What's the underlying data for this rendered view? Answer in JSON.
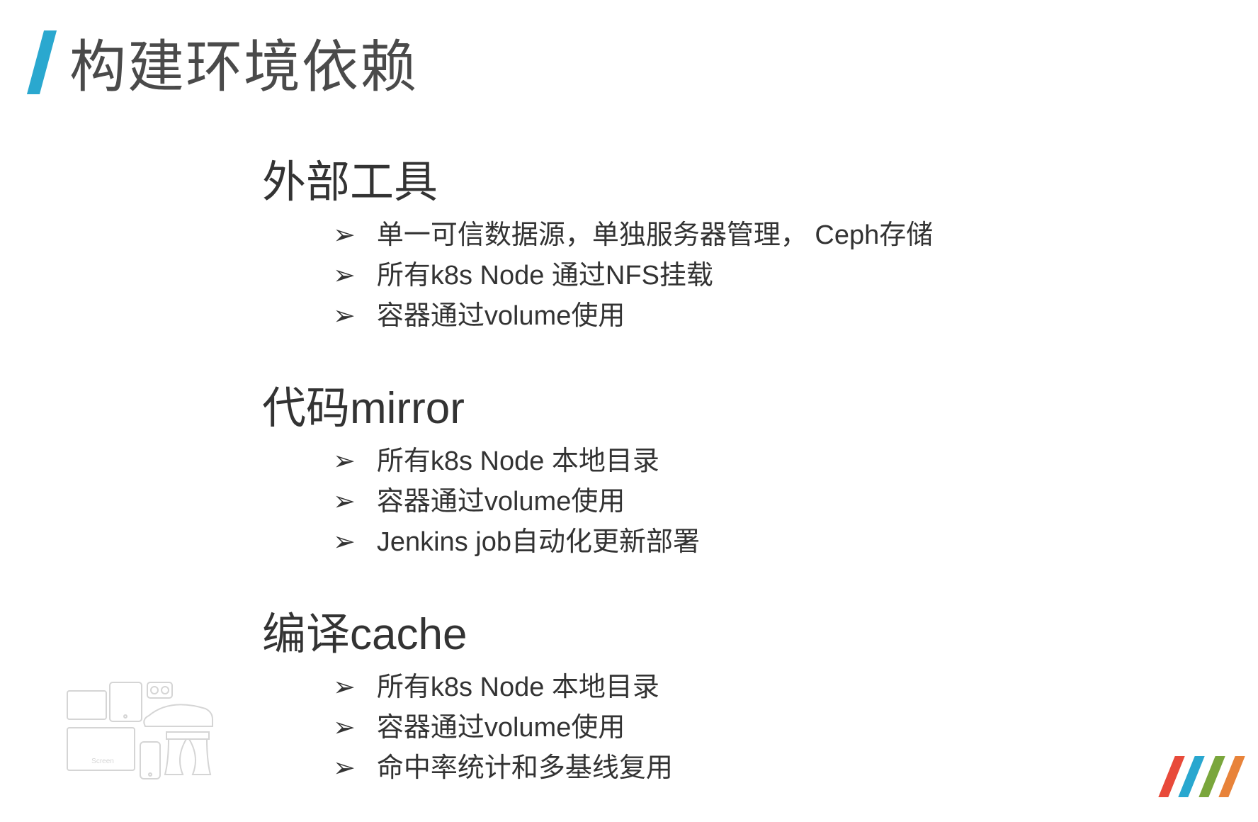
{
  "title": "构建环境依赖",
  "sections": [
    {
      "heading": "外部工具",
      "bullets": [
        "单一可信数据源，单独服务器管理，  Ceph存储",
        "所有k8s Node 通过NFS挂载",
        "容器通过volume使用"
      ]
    },
    {
      "heading": "代码mirror",
      "bullets": [
        "所有k8s Node 本地目录",
        "容器通过volume使用",
        "Jenkins job自动化更新部署"
      ]
    },
    {
      "heading": "编译cache",
      "bullets": [
        "所有k8s Node 本地目录",
        "容器通过volume使用",
        "命中率统计和多基线复用"
      ]
    }
  ],
  "bullet_glyph": "➢"
}
